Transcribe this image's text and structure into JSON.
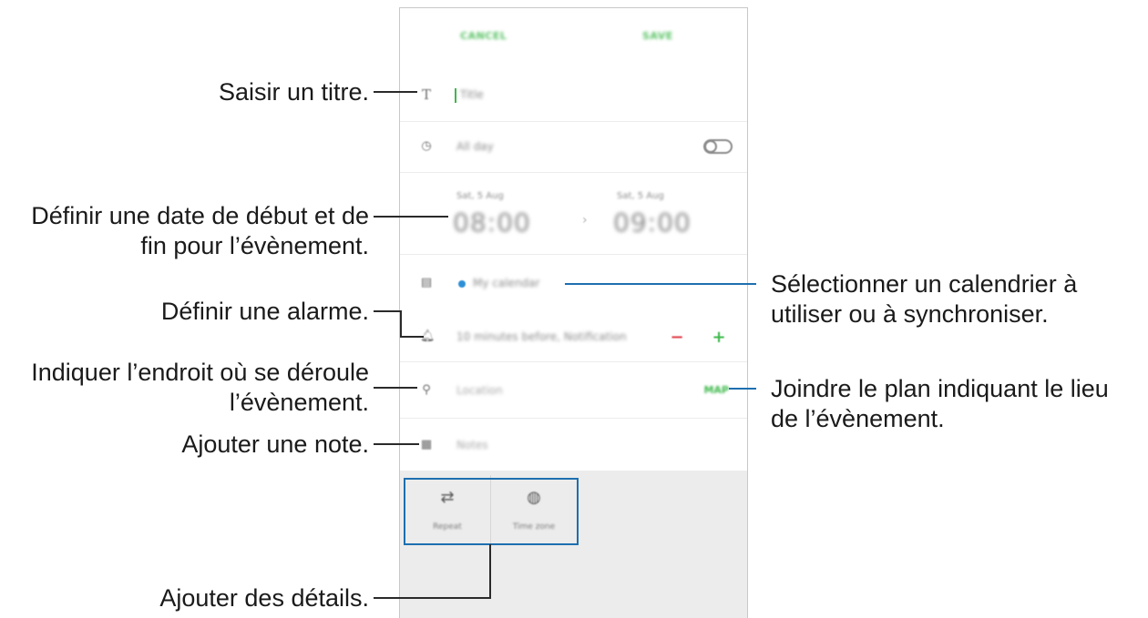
{
  "annotations": {
    "title": "Saisir un titre.",
    "dates_line1": "Définir une date de début et de",
    "dates_line2": "fin pour l’évènement.",
    "alarm": "Définir une alarme.",
    "location_line1": "Indiquer l’endroit où se déroule",
    "location_line2": "l’évènement.",
    "note": "Ajouter une note.",
    "details": "Ajouter des détails.",
    "calendar_line1": "Sélectionner un calendrier à",
    "calendar_line2": "utiliser ou à synchroniser.",
    "map_line1": "Joindre le plan indiquant le lieu",
    "map_line2": "de l’évènement."
  },
  "app": {
    "cancel_label": "CANCEL",
    "save_label": "SAVE",
    "title_placeholder": "Title",
    "allday_label": "All day",
    "start_label": "Sat, 5 Aug",
    "start_time": "08:00",
    "end_label": "Sat, 5 Aug",
    "end_time": "09:00",
    "calendar_name": "My calendar",
    "reminder_text": "10 minutes before, Notification",
    "location_placeholder": "Location",
    "map_button": "MAP",
    "notes_placeholder": "Notes",
    "details": [
      {
        "label": "Repeat",
        "icon": "repeat-icon"
      },
      {
        "label": "Time zone",
        "icon": "globe-icon"
      }
    ]
  },
  "colors": {
    "accent_green": "#3cb84a",
    "calendar_dot": "#2d8fd6",
    "minus_red": "#e0404a",
    "callout_blue": "#1e6fb0"
  }
}
